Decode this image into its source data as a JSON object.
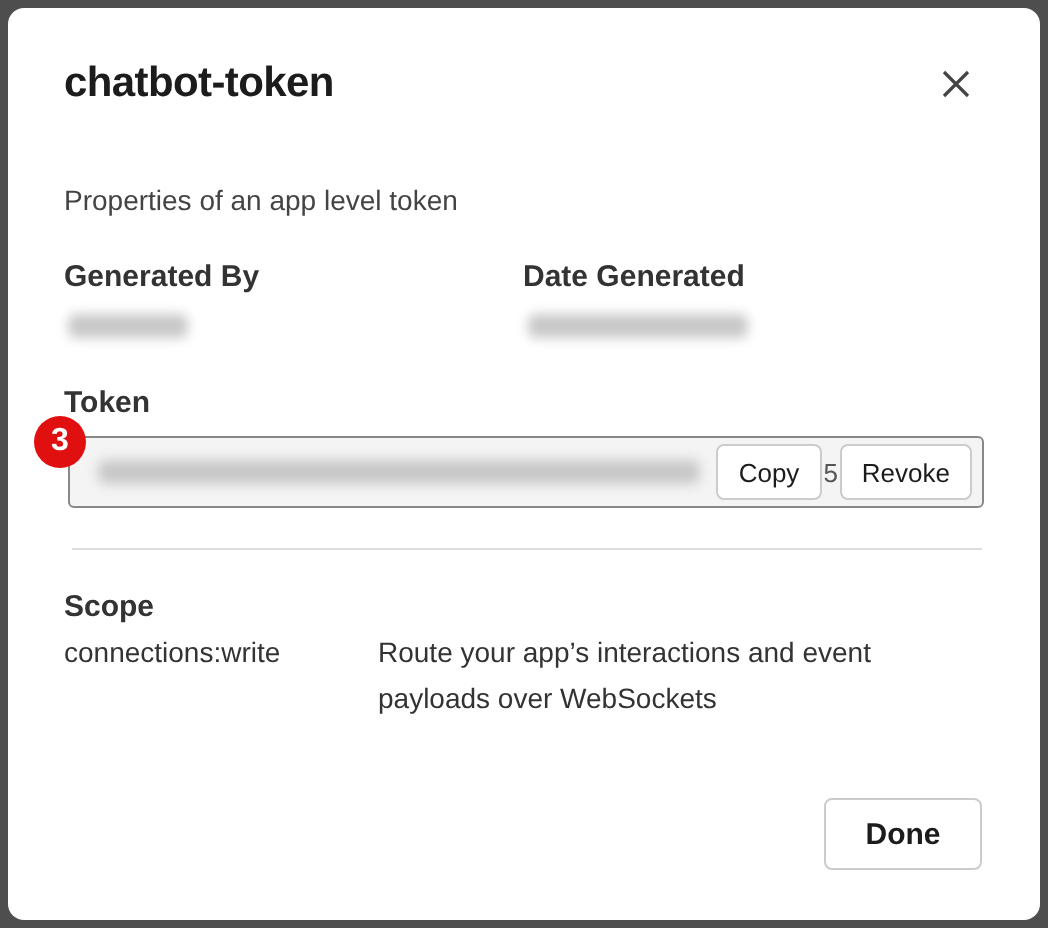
{
  "dialog": {
    "title": "chatbot-token",
    "subtitle": "Properties of an app level token",
    "details": [
      {
        "label": "Generated By"
      },
      {
        "label": "Date Generated"
      }
    ],
    "badge": "3",
    "token": {
      "label": "Token",
      "visible_tail": "5",
      "buttons": [
        "Copy",
        "Revoke"
      ]
    },
    "scope": {
      "label": "Scope",
      "items": [
        {
          "name": "connections:write",
          "description": "Route your app’s interactions and event payloads over WebSockets"
        }
      ]
    },
    "buttons": [
      "Done"
    ]
  }
}
